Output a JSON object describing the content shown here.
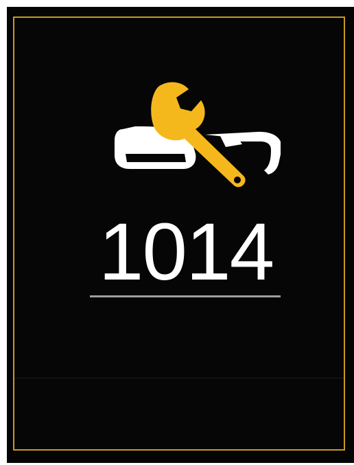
{
  "screen": {
    "icon": "maintenance-wrench-icon",
    "value": "1014",
    "accent_color": "#f5b81c",
    "frame_color": "#c99a1e",
    "icon_color": "#ffffff"
  }
}
